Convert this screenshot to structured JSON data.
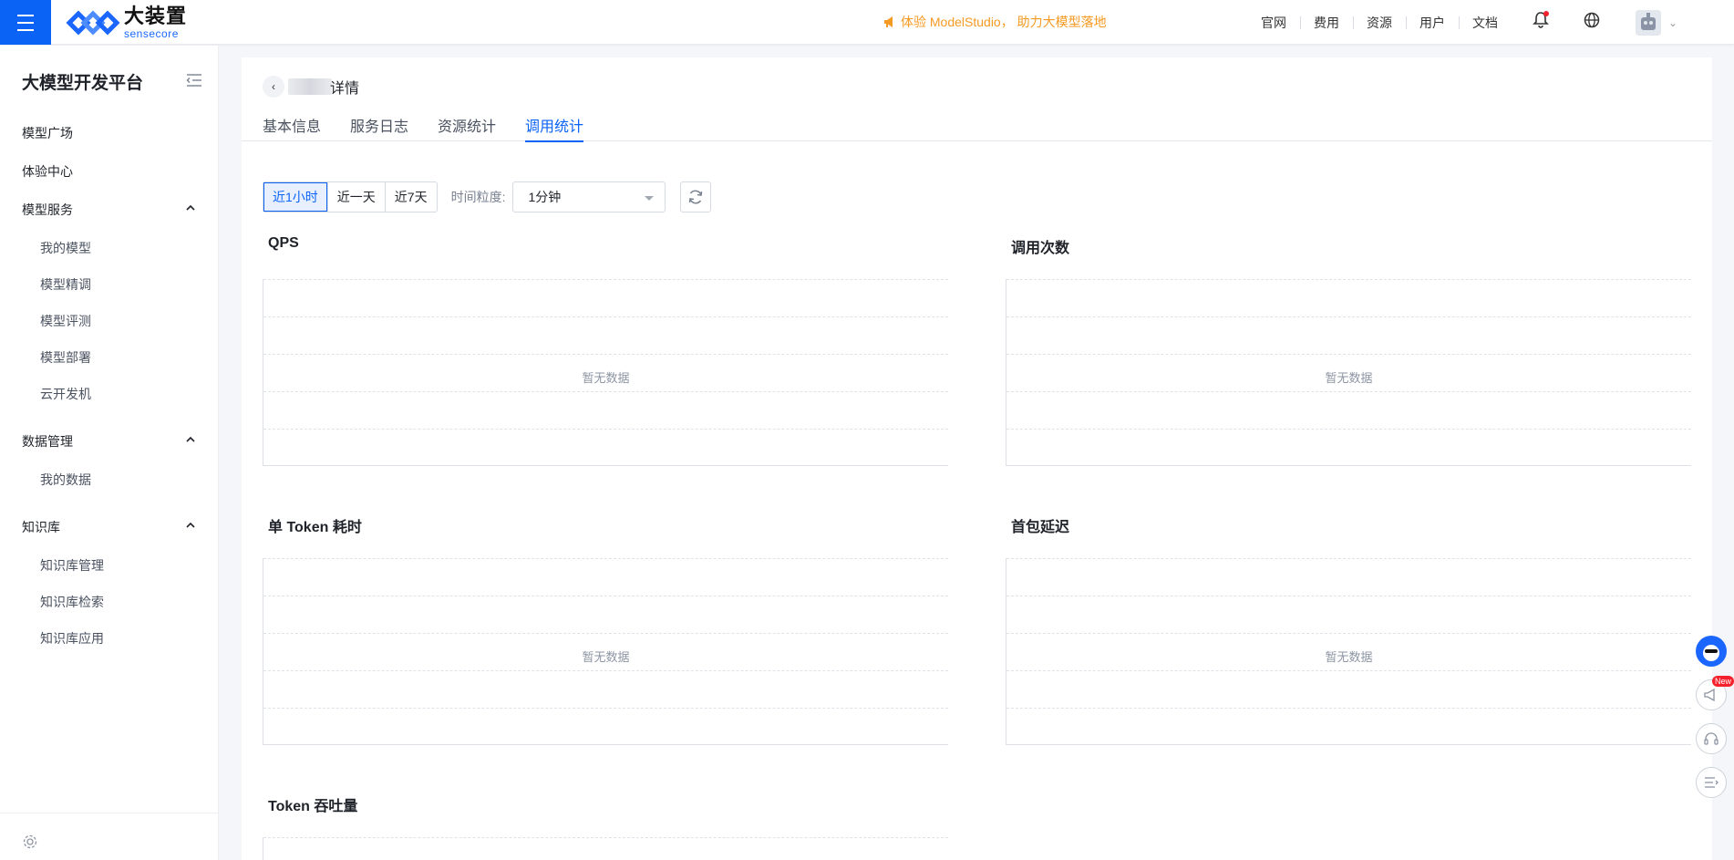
{
  "header": {
    "logo_cn": "大装置",
    "logo_en": "sensecore",
    "promo": "体验 ModelStudio， 助力大模型落地",
    "links": [
      "官网",
      "费用",
      "资源",
      "用户",
      "文档"
    ],
    "accent": "#0b63f6",
    "promo_color": "#f59a23"
  },
  "sidebar": {
    "title": "大模型开发平台",
    "items": [
      {
        "label": "模型广场"
      },
      {
        "label": "体验中心"
      },
      {
        "label": "模型服务",
        "children": [
          "我的模型",
          "模型精调",
          "模型评测",
          "模型部署",
          "云开发机"
        ]
      },
      {
        "label": "数据管理",
        "children": [
          "我的数据"
        ]
      },
      {
        "label": "知识库",
        "children": [
          "知识库管理",
          "知识库检索",
          "知识库应用"
        ]
      }
    ]
  },
  "page": {
    "title": "详情",
    "tabs": [
      "基本信息",
      "服务日志",
      "资源统计",
      "调用统计"
    ],
    "active_tab": "调用统计"
  },
  "filters": {
    "ranges": [
      "近1小时",
      "近一天",
      "近7天"
    ],
    "active_range": "近1小时",
    "granularity_label": "时间粒度:",
    "granularity_value": "1分钟"
  },
  "charts": [
    {
      "title": "QPS",
      "empty": "暂无数据"
    },
    {
      "title": "调用次数",
      "empty": "暂无数据"
    },
    {
      "title": "单 Token 耗时",
      "empty": "暂无数据"
    },
    {
      "title": "首包延迟",
      "empty": "暂无数据"
    },
    {
      "title": "Token 吞吐量",
      "empty": ""
    }
  ],
  "float_badge": "New"
}
